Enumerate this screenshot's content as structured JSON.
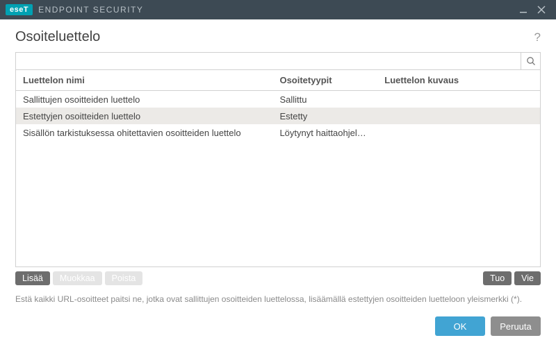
{
  "brand": {
    "logo": "eseT",
    "product": "ENDPOINT SECURITY"
  },
  "page": {
    "title": "Osoiteluettelo"
  },
  "search": {
    "placeholder": ""
  },
  "table": {
    "headers": {
      "name": "Luettelon nimi",
      "type": "Osoitetyypit",
      "desc": "Luettelon kuvaus"
    },
    "rows": [
      {
        "name": "Sallittujen osoitteiden luettelo",
        "type": "Sallittu",
        "desc": "",
        "selected": false
      },
      {
        "name": "Estettyjen osoitteiden luettelo",
        "type": "Estetty",
        "desc": "",
        "selected": true
      },
      {
        "name": "Sisällön tarkistuksessa ohitettavien osoitteiden luettelo",
        "type": "Löytynyt haittaohjelma o...",
        "desc": "",
        "selected": false
      }
    ]
  },
  "actions": {
    "add": "Lisää",
    "edit": "Muokkaa",
    "delete": "Poista",
    "import": "Tuo",
    "export": "Vie"
  },
  "hint": "Estä kaikki URL-osoitteet paitsi ne, jotka ovat sallittujen osoitteiden luettelossa, lisäämällä estettyjen osoitteiden luetteloon yleismerkki (*).",
  "footer": {
    "ok": "OK",
    "cancel": "Peruuta"
  }
}
